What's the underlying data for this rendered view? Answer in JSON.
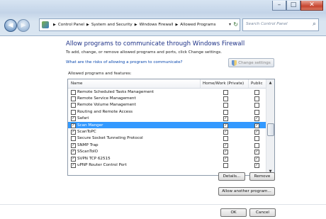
{
  "window": {
    "minimize": "–",
    "maximize": "□",
    "close": "✕"
  },
  "nav": {
    "back": "◀",
    "forward": "▶",
    "breadcrumbs": [
      "Control Panel",
      "System and Security",
      "Windows Firewall",
      "Allowed Programs"
    ],
    "search_placeholder": "Search Control Panel"
  },
  "page": {
    "title": "Allow programs to communicate through Windows Firewall",
    "subtitle": "To add, change, or remove allowed programs and ports, click Change settings.",
    "risk_link": "What are the risks of allowing a program to communicate?",
    "change_settings": "Change settings",
    "group_label": "Allowed programs and features:"
  },
  "list": {
    "columns": {
      "name": "Name",
      "home": "Home/Work (Private)",
      "public": "Public"
    },
    "rows": [
      {
        "name": "Remote Scheduled Tasks Management",
        "enabled": false,
        "home": false,
        "public": false
      },
      {
        "name": "Remote Service Management",
        "enabled": false,
        "home": false,
        "public": false
      },
      {
        "name": "Remote Volume Management",
        "enabled": false,
        "home": false,
        "public": false
      },
      {
        "name": "Routing and Remote Access",
        "enabled": false,
        "home": false,
        "public": false
      },
      {
        "name": "Safari",
        "enabled": true,
        "home": true,
        "public": true
      },
      {
        "name": "Scan Manger",
        "enabled": true,
        "home": true,
        "public": true,
        "selected": true
      },
      {
        "name": "ScanToPC",
        "enabled": true,
        "home": true,
        "public": true
      },
      {
        "name": "Secure Socket Tunneling Protocol",
        "enabled": false,
        "home": false,
        "public": false
      },
      {
        "name": "SNMP Trap",
        "enabled": true,
        "home": true,
        "public": false
      },
      {
        "name": "SScanToIO",
        "enabled": true,
        "home": true,
        "public": true
      },
      {
        "name": "SVPN TCP 62515",
        "enabled": true,
        "home": true,
        "public": true
      },
      {
        "name": "uPNP Router Control Port",
        "enabled": true,
        "home": false,
        "public": true
      }
    ]
  },
  "buttons": {
    "details": "Details...",
    "remove": "Remove",
    "allow_another": "Allow another program...",
    "ok": "OK",
    "cancel": "Cancel"
  },
  "colors": {
    "title": "#1e3287",
    "link": "#0645ad",
    "selection": "#3399ff"
  }
}
